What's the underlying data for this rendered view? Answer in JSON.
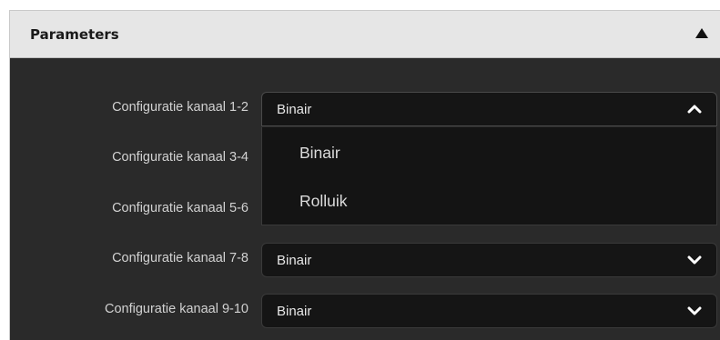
{
  "panel": {
    "title": "Parameters",
    "collapse_icon": "triangle-up-icon"
  },
  "rows": [
    {
      "label": "Configuratie kanaal 1-2",
      "value": "Binair",
      "state": "open"
    },
    {
      "label": "Configuratie kanaal 3-4",
      "value": "",
      "state": "covered"
    },
    {
      "label": "Configuratie kanaal 5-6",
      "value": "",
      "state": "covered"
    },
    {
      "label": "Configuratie kanaal 7-8",
      "value": "Binair",
      "state": "closed"
    },
    {
      "label": "Configuratie kanaal 9-10",
      "value": "Binair",
      "state": "closed"
    }
  ],
  "dropdown": {
    "options": [
      "Binair",
      "Rolluik"
    ]
  },
  "icons": {
    "open_select": "chevron-up-icon",
    "closed_select": "chevron-down-icon"
  },
  "colors": {
    "panel_background": "#2a2a2a",
    "header_background": "#e6e6e6",
    "select_background": "#151515",
    "text": "#d2d2d2"
  }
}
